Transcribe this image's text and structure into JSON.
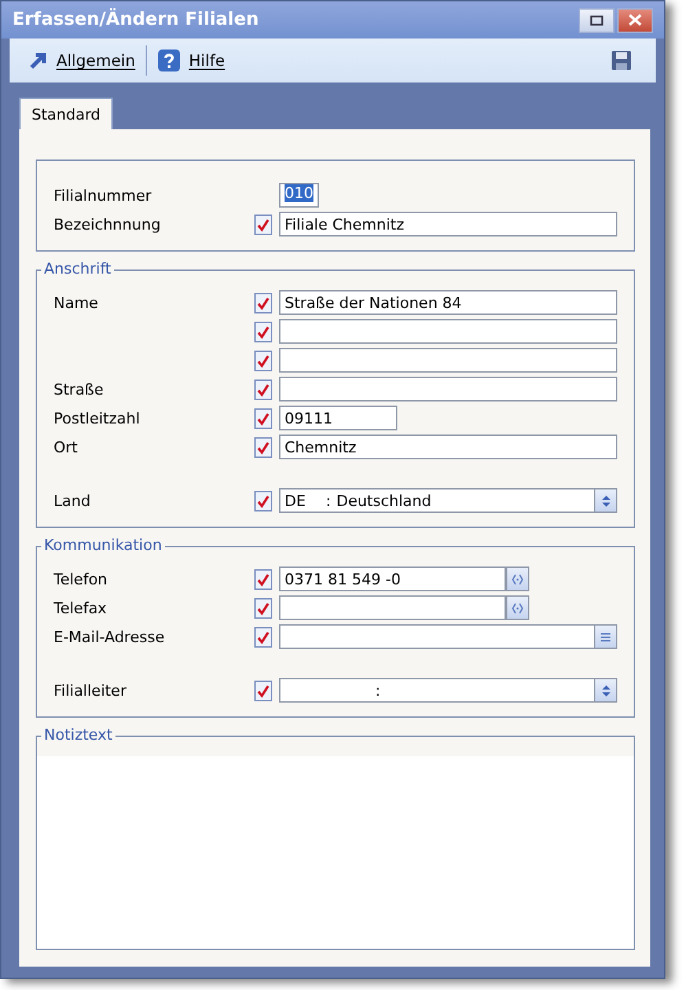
{
  "window": {
    "title": "Erfassen/Ändern Filialen"
  },
  "toolbar": [
    {
      "label": "Allgemein",
      "kind": "arrow"
    },
    {
      "label": "Hilfe",
      "kind": "help"
    }
  ],
  "tabs": [
    {
      "label": "Standard",
      "selected": true
    }
  ],
  "sections": [
    {
      "row_groups": [
        [
          {
            "label": "Filialnummer",
            "checked": false,
            "field": {
              "kind": "code",
              "value": "010",
              "highlighted": true
            }
          },
          {
            "label": "Bezeichnnung",
            "checked": true,
            "field": {
              "kind": "text",
              "value": "Filiale Chemnitz"
            }
          }
        ]
      ]
    },
    {
      "title": "Anschrift",
      "row_groups": [
        [
          {
            "label": "Name",
            "checked": true,
            "field": {
              "kind": "text",
              "value": "Straße der Nationen 84"
            }
          },
          {
            "checked": true,
            "field": {
              "kind": "text"
            }
          },
          {
            "checked": true,
            "field": {
              "kind": "text"
            }
          },
          {
            "label": "Straße",
            "checked": true,
            "field": {
              "kind": "text"
            }
          },
          {
            "label": "Postleitzahl",
            "checked": true,
            "field": {
              "kind": "zip",
              "value": "09111"
            }
          },
          {
            "label": "Ort",
            "checked": true,
            "field": {
              "kind": "text",
              "value": "Chemnitz"
            }
          }
        ],
        [
          {
            "label": "Land",
            "checked": true,
            "field": {
              "kind": "select",
              "code": "DE",
              "separator": ":",
              "name": "Deutschland"
            }
          }
        ]
      ]
    },
    {
      "title": "Kommunikation",
      "row_groups": [
        [
          {
            "label": "Telefon",
            "checked": true,
            "field": {
              "kind": "phone",
              "value": "0371 81 549 -0"
            }
          },
          {
            "label": "Telefax",
            "checked": true,
            "field": {
              "kind": "phone"
            }
          },
          {
            "label": "E-Mail-Adresse",
            "checked": true,
            "field": {
              "kind": "email"
            }
          }
        ],
        [
          {
            "label": "Filialleiter",
            "checked": true,
            "field": {
              "kind": "select",
              "separator": ":"
            }
          }
        ]
      ]
    }
  ],
  "notes": {
    "title": "Notiztext"
  }
}
